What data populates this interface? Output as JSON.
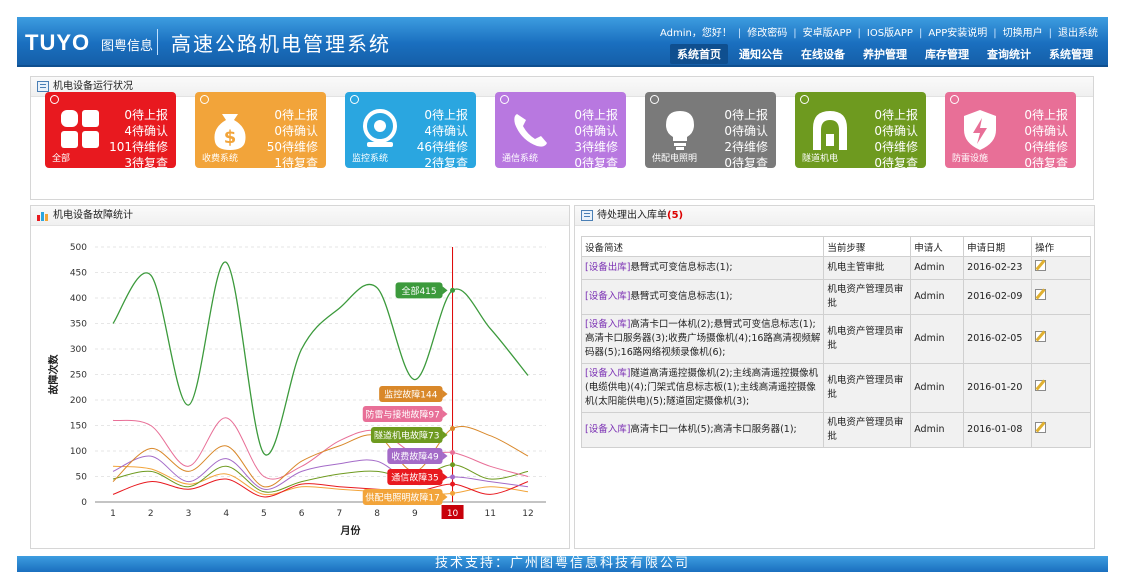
{
  "header": {
    "logo": "TUYO",
    "logo_sub": "图粤信息",
    "system_title": "高速公路机电管理系统",
    "top_links": [
      "Admin，您好！",
      "修改密码",
      "安卓版APP",
      "IOS版APP",
      "APP安装说明",
      "切换用户",
      "退出系统"
    ],
    "nav": [
      "系统首页",
      "通知公告",
      "在线设备",
      "养护管理",
      "库存管理",
      "查询统计",
      "系统管理"
    ],
    "active_nav": 0
  },
  "status_panel": {
    "title": "机电设备运行状况",
    "cards": [
      {
        "name": "全部",
        "color": "#e8191f",
        "icon": "grid-icon",
        "lines": [
          "0待上报",
          "4待确认",
          "101待维修",
          "3待复查"
        ]
      },
      {
        "name": "收费系统",
        "color": "#f2a43a",
        "icon": "money-bag-icon",
        "lines": [
          "0待上报",
          "0待确认",
          "50待维修",
          "1待复查"
        ]
      },
      {
        "name": "监控系统",
        "color": "#2aa6e0",
        "icon": "camera-icon",
        "lines": [
          "0待上报",
          "4待确认",
          "46待维修",
          "2待复查"
        ]
      },
      {
        "name": "通信系统",
        "color": "#b878e0",
        "icon": "phone-icon",
        "lines": [
          "0待上报",
          "0待确认",
          "3待维修",
          "0待复查"
        ]
      },
      {
        "name": "供配电照明",
        "color": "#7a7a7a",
        "icon": "bulb-icon",
        "lines": [
          "0待上报",
          "0待确认",
          "2待维修",
          "0待复查"
        ]
      },
      {
        "name": "隧道机电",
        "color": "#6e9a1f",
        "icon": "tunnel-icon",
        "lines": [
          "0待上报",
          "0待确认",
          "0待维修",
          "0待复查"
        ]
      },
      {
        "name": "防雷设施",
        "color": "#e86f97",
        "icon": "lightning-shield-icon",
        "lines": [
          "0待上报",
          "0待确认",
          "0待维修",
          "0待复查"
        ]
      }
    ]
  },
  "chart_panel": {
    "title": "机电设备故障统计"
  },
  "chart_data": {
    "type": "line",
    "x": [
      1,
      2,
      3,
      4,
      5,
      6,
      7,
      8,
      9,
      10,
      11,
      12
    ],
    "xlabel": "月份",
    "ylabel": "故障次数",
    "ylim": [
      0,
      500
    ],
    "yticks": [
      0,
      50,
      100,
      150,
      200,
      250,
      300,
      350,
      400,
      450,
      500
    ],
    "highlight_x": 10,
    "series": [
      {
        "name": "全部",
        "color": "#3c9a3c",
        "values": [
          350,
          445,
          190,
          470,
          95,
          300,
          380,
          420,
          240,
          415,
          340,
          248
        ],
        "label": "全部415"
      },
      {
        "name": "监控故障",
        "color": "#d9882a",
        "values": [
          40,
          105,
          60,
          110,
          30,
          80,
          110,
          130,
          60,
          144,
          130,
          90
        ],
        "label": "监控故障144"
      },
      {
        "name": "防雷与接地故障",
        "color": "#e86f97",
        "values": [
          160,
          150,
          70,
          165,
          50,
          70,
          120,
          140,
          95,
          97,
          70,
          50
        ],
        "label": "防雷与接地故障97"
      },
      {
        "name": "隧道机电故障",
        "color": "#6e9a1f",
        "values": [
          45,
          60,
          30,
          70,
          20,
          40,
          55,
          60,
          45,
          73,
          45,
          60
        ],
        "label": "隧道机电故障73"
      },
      {
        "name": "收费故障",
        "color": "#a46bc8",
        "values": [
          60,
          90,
          40,
          85,
          25,
          60,
          75,
          80,
          35,
          49,
          40,
          30
        ],
        "label": "收费故障49"
      },
      {
        "name": "通信故障",
        "color": "#e8191f",
        "values": [
          15,
          40,
          25,
          45,
          10,
          35,
          30,
          25,
          20,
          35,
          15,
          40
        ],
        "label": "通信故障35"
      },
      {
        "name": "供配电照明故障",
        "color": "#f2a43a",
        "values": [
          70,
          65,
          35,
          55,
          15,
          30,
          25,
          20,
          15,
          17,
          30,
          20
        ],
        "label": "供配电照明故障17"
      }
    ]
  },
  "request_panel": {
    "title": "待处理出入库单",
    "count": "(5)",
    "columns": [
      "设备简述",
      "当前步骤",
      "申请人",
      "申请日期",
      "操作"
    ],
    "rows": [
      {
        "tag": "[设备出库]",
        "desc": "悬臂式可变信息标志(1);",
        "step": "机电主管审批",
        "applicant": "Admin",
        "date": "2016-02-23"
      },
      {
        "tag": "[设备入库]",
        "desc": "悬臂式可变信息标志(1);",
        "step": "机电资产管理员审批",
        "applicant": "Admin",
        "date": "2016-02-09"
      },
      {
        "tag": "[设备入库]",
        "desc": "高清卡口一体机(2);悬臂式可变信息标志(1);高清卡口服务器(3);收费广场摄像机(4);16路高清视频解码器(5);16路网络视频录像机(6);",
        "step": "机电资产管理员审批",
        "applicant": "Admin",
        "date": "2016-02-05"
      },
      {
        "tag": "[设备入库]",
        "desc": "隧道高清遥控摄像机(2);主线高清遥控摄像机(电缆供电)(4);门架式信息标志板(1);主线高清遥控摄像机(太阳能供电)(5);隧道固定摄像机(3);",
        "step": "机电资产管理员审批",
        "applicant": "Admin",
        "date": "2016-01-20"
      },
      {
        "tag": "[设备入库]",
        "desc": "高清卡口一体机(5);高清卡口服务器(1);",
        "step": "机电资产管理员审批",
        "applicant": "Admin",
        "date": "2016-01-08"
      }
    ]
  },
  "footer": {
    "text": "技术支持：广州图粤信息科技有限公司"
  }
}
